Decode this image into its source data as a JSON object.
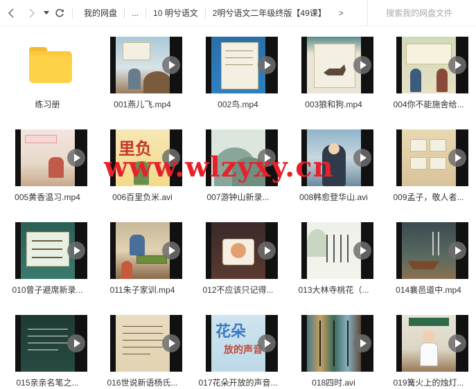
{
  "toolbar": {
    "back_icon": "chevron-left-icon",
    "forward_icon": "chevron-right-icon",
    "history_icon": "caret-down-icon",
    "refresh_icon": "refresh-icon",
    "breadcrumbs": [
      "我的网盘",
      "...",
      "10 明兮语文",
      "2明兮语文二年级终版【49课】"
    ],
    "more_arrow": ">",
    "search_placeholder": "搜索我的网盘文件"
  },
  "watermark": "www.wlzyxy.cn",
  "files": [
    {
      "name": "练习册",
      "type": "folder"
    },
    {
      "name": "001燕儿飞.mp4",
      "type": "video",
      "scene": "study-room"
    },
    {
      "name": "002鸟.mp4",
      "type": "video",
      "scene": "book"
    },
    {
      "name": "003狼和狗.mp4",
      "type": "video",
      "scene": "wolf-dog"
    },
    {
      "name": "004你不能施舍给...",
      "type": "video",
      "scene": "sign"
    },
    {
      "name": "005黄香温习.mp4",
      "type": "video",
      "scene": "room"
    },
    {
      "name": "006百里负米.avi",
      "type": "video",
      "scene": "title-art"
    },
    {
      "name": "007游钟山新录...",
      "type": "video",
      "scene": "mountain"
    },
    {
      "name": "008韩愈登华山.avi",
      "type": "video",
      "scene": "scholar"
    },
    {
      "name": "009孟子，敬人者...",
      "type": "video",
      "scene": "signs"
    },
    {
      "name": "010曾子避席新录...",
      "type": "video",
      "scene": "board"
    },
    {
      "name": "011朱子家训.mp4",
      "type": "video",
      "scene": "table"
    },
    {
      "name": "012不应该只记得...",
      "type": "video",
      "scene": "cake"
    },
    {
      "name": "013大林寺桃花（...",
      "type": "video",
      "scene": "poem"
    },
    {
      "name": "014襄邑道中.mp4",
      "type": "video",
      "scene": "boat"
    },
    {
      "name": "015亲亲名笔之...",
      "type": "video",
      "scene": "chalkboard"
    },
    {
      "name": "016世说新语杨氏...",
      "type": "video",
      "scene": "scroll"
    },
    {
      "name": "017花朵开放的声音...",
      "type": "video",
      "scene": "flower"
    },
    {
      "name": "018四时.avi",
      "type": "video",
      "scene": "seasons"
    },
    {
      "name": "019篝火上的烛灯...",
      "type": "video",
      "scene": "classroom"
    }
  ]
}
